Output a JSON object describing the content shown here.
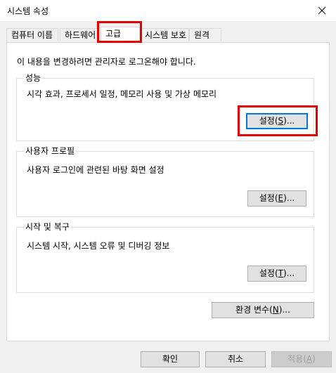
{
  "window": {
    "title": "시스템 속성",
    "close_icon": "close-icon"
  },
  "tabs": [
    {
      "label": "컴퓨터 이름",
      "active": false
    },
    {
      "label": "하드웨어",
      "active": false
    },
    {
      "label": "고급",
      "active": true
    },
    {
      "label": "시스템 보호",
      "active": false
    },
    {
      "label": "원격",
      "active": false
    }
  ],
  "advanced": {
    "admin_notice": "이 내용을 변경하려면 관리자로 로그온해야 합니다.",
    "performance": {
      "title": "성능",
      "description": "시각 효과, 프로세서 일정, 메모리 사용 및 가상 메모리",
      "settings_button": {
        "prefix": "설정(",
        "mnemonic": "S",
        "suffix": ")..."
      }
    },
    "user_profiles": {
      "title": "사용자 프로필",
      "description": "사용자 로그인에 관련된 바탕 화면 설정",
      "settings_button": {
        "prefix": "설정(",
        "mnemonic": "E",
        "suffix": ")..."
      }
    },
    "startup_recovery": {
      "title": "시작 및 복구",
      "description": "시스템 시작, 시스템 오류 및 디버깅 정보",
      "settings_button": {
        "prefix": "설정(",
        "mnemonic": "T",
        "suffix": ")..."
      }
    },
    "env_button": {
      "prefix": "환경 변수(",
      "mnemonic": "N",
      "suffix": ")..."
    }
  },
  "footer": {
    "ok_label": "확인",
    "cancel_label": "취소",
    "apply_button": {
      "prefix": "적용(",
      "mnemonic": "A",
      "suffix": ")"
    }
  },
  "highlight_color": "#e60000",
  "accent_color": "#0078d7"
}
